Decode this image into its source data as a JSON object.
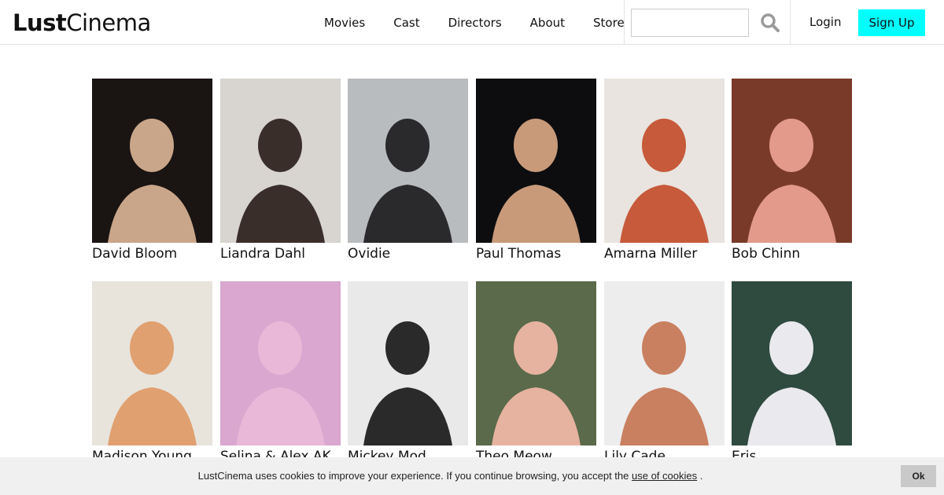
{
  "header": {
    "logo_bold": "Lust",
    "logo_light": "Cinema",
    "nav": [
      "Movies",
      "Cast",
      "Directors",
      "About",
      "Store"
    ],
    "search_placeholder": "",
    "login_label": "Login",
    "signup_label": "Sign Up",
    "accent_color": "#00ffff"
  },
  "people": [
    {
      "name": "David Bloom",
      "bg": "#1a1412",
      "fg": "#c9a68a"
    },
    {
      "name": "Liandra Dahl",
      "bg": "#d8d4cf",
      "fg": "#3a2e2a"
    },
    {
      "name": "Ovidie",
      "bg": "#b9bcbf",
      "fg": "#2a2a2c"
    },
    {
      "name": "Paul Thomas",
      "bg": "#0d0d0f",
      "fg": "#c89a7a"
    },
    {
      "name": "Amarna Miller",
      "bg": "#e9e4df",
      "fg": "#c65a3a"
    },
    {
      "name": "Bob Chinn",
      "bg": "#7a3a2a",
      "fg": "#e39a8a"
    },
    {
      "name": "Madison Young",
      "bg": "#e8e4dc",
      "fg": "#e0a070"
    },
    {
      "name": "Selina & Alex AK",
      "bg": "#d9a7cf",
      "fg": "#e9b8d8"
    },
    {
      "name": "Mickey Mod",
      "bg": "#e9e9e9",
      "fg": "#2a2a2a"
    },
    {
      "name": "Theo Meow",
      "bg": "#5a6a4a",
      "fg": "#e6b3a0"
    },
    {
      "name": "Lily Cade",
      "bg": "#ededed",
      "fg": "#c98060"
    },
    {
      "name": "Eris",
      "bg": "#2f4a3f",
      "fg": "#e9e9ee"
    }
  ],
  "cookie": {
    "text": "LustCinema uses cookies to improve your experience. If you continue browsing, you accept the",
    "link": "use of cookies",
    "end": ".",
    "ok_label": "Ok"
  }
}
